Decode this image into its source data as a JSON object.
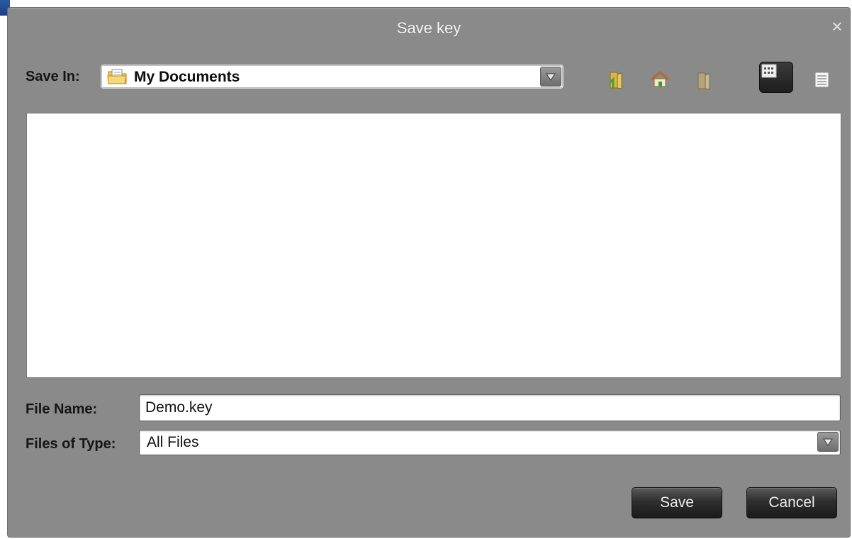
{
  "dialog": {
    "title": "Save key",
    "close_glyph": "×"
  },
  "save_in": {
    "label": "Save In:",
    "value": "My Documents",
    "icon": "folder-documents-icon"
  },
  "toolbar": {
    "icons": [
      "up-folder-icon",
      "home-icon",
      "new-folder-icon",
      "list-view-icon",
      "details-view-icon"
    ],
    "active_view": "list-view"
  },
  "file_name": {
    "label": "File Name:",
    "value": "Demo.key"
  },
  "file_type": {
    "label": "Files of Type:",
    "value": "All Files"
  },
  "buttons": {
    "save": "Save",
    "cancel": "Cancel"
  },
  "colors": {
    "dialog_bg": "#8a8a8a",
    "button_dark": "#1a1a1a",
    "edge_accent": "#2a5aa8"
  }
}
